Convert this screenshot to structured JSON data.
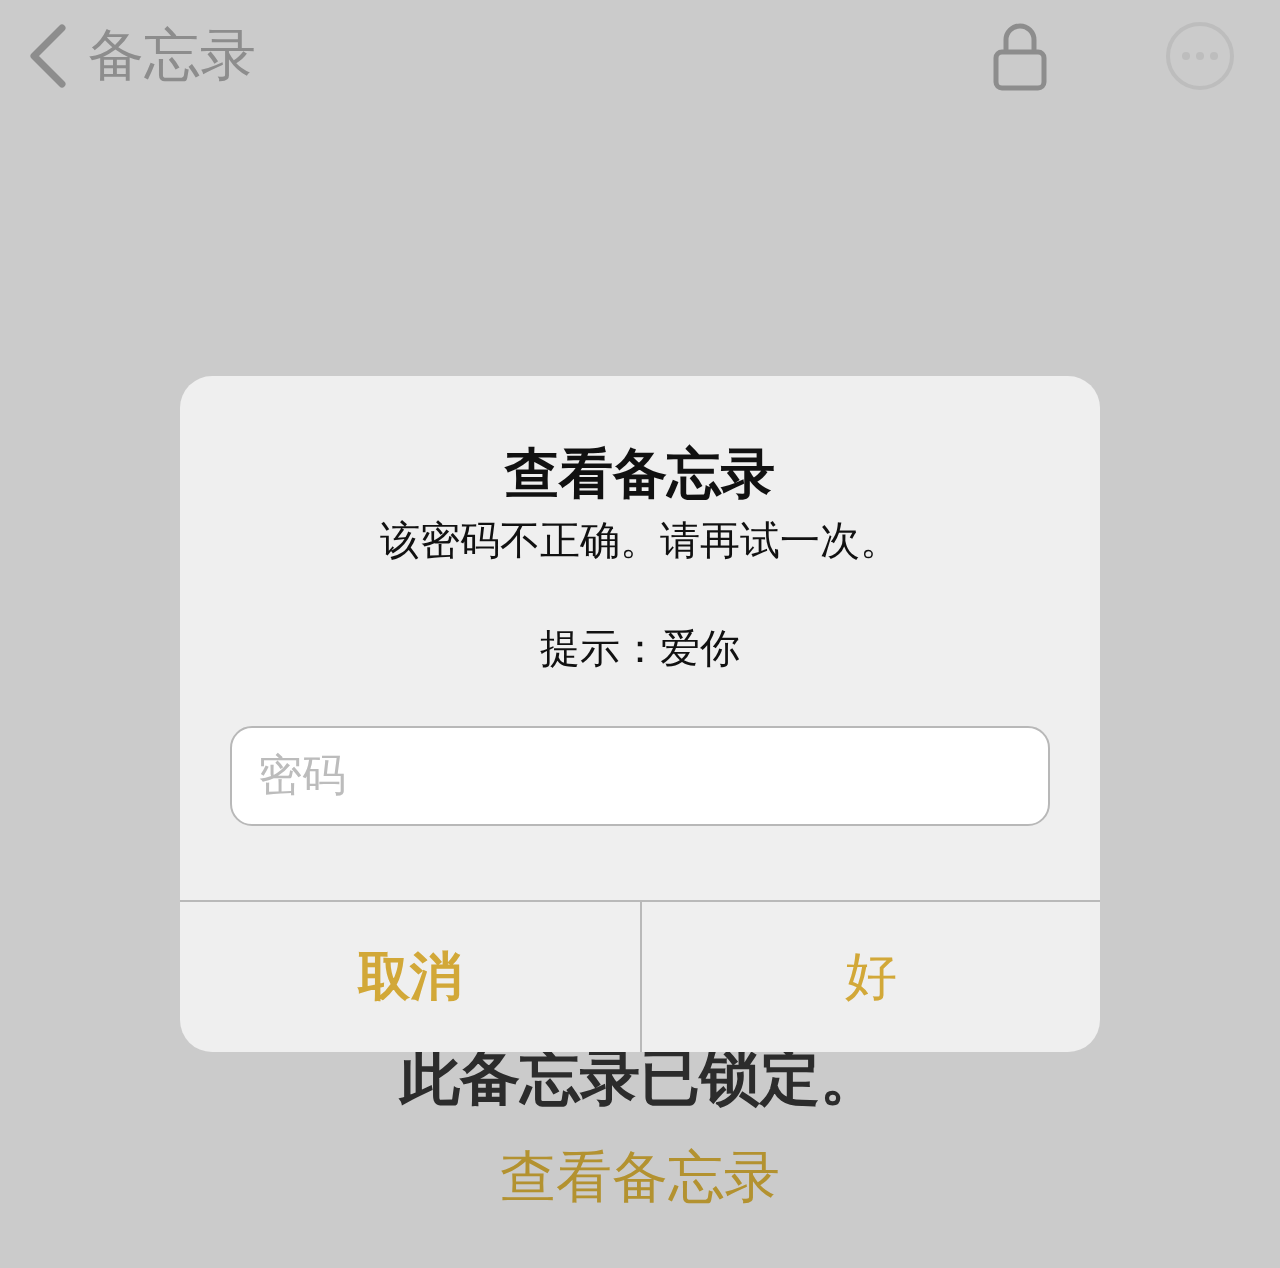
{
  "nav": {
    "back_label": "备忘录"
  },
  "alert": {
    "title": "查看备忘录",
    "message": "该密码不正确。请再试一次。",
    "hint": "提示：爱你",
    "password_field": {
      "placeholder": "密码"
    },
    "buttons": [
      {
        "label": "取消",
        "kind": "cancel"
      },
      {
        "label": "好",
        "kind": "confirm"
      }
    ]
  },
  "locked": {
    "message": "此备忘录已锁定。",
    "link": "查看备忘录"
  }
}
